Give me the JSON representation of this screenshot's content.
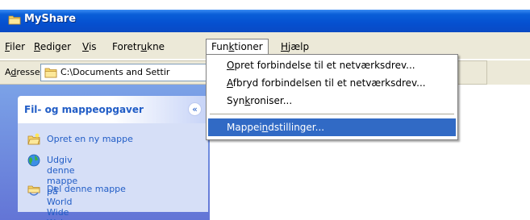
{
  "window": {
    "title": "MyShare",
    "icon": "folder-icon"
  },
  "menubar": {
    "items": [
      {
        "label": "Filer"
      },
      {
        "label": "Rediger"
      },
      {
        "label": "Vis"
      },
      {
        "label": "Foretrukne"
      },
      {
        "label": "Funktioner"
      },
      {
        "label": "Hjælp"
      }
    ],
    "active": "Funktioner"
  },
  "address": {
    "label": "Adresse",
    "value": "C:\\Documents and Settir"
  },
  "dropdown": {
    "items": [
      {
        "label": "Opret forbindelse til et netværksdrev..."
      },
      {
        "label": "Afbryd forbindelsen til et netværksdrev..."
      },
      {
        "label": "Synkroniser..."
      },
      {
        "label": "Mappeindstillinger..."
      }
    ],
    "selected_index": 3
  },
  "taskpane": {
    "header": "Fil- og mappeopgaver",
    "collapse_icon": "double-chevron-up-icon",
    "tasks": [
      {
        "label": "Opret en ny mappe",
        "icon": "new-folder-icon"
      },
      {
        "label": "Udgiv denne mappe på\nWorld Wide Web",
        "icon": "globe-icon"
      },
      {
        "label": "Del denne mappe",
        "icon": "share-folder-icon"
      }
    ]
  },
  "colors": {
    "titlebar": "#0550d0",
    "menu_highlight": "#316ac5",
    "taskpane_link": "#215dc6",
    "menubar_bg": "#ece9d8"
  }
}
